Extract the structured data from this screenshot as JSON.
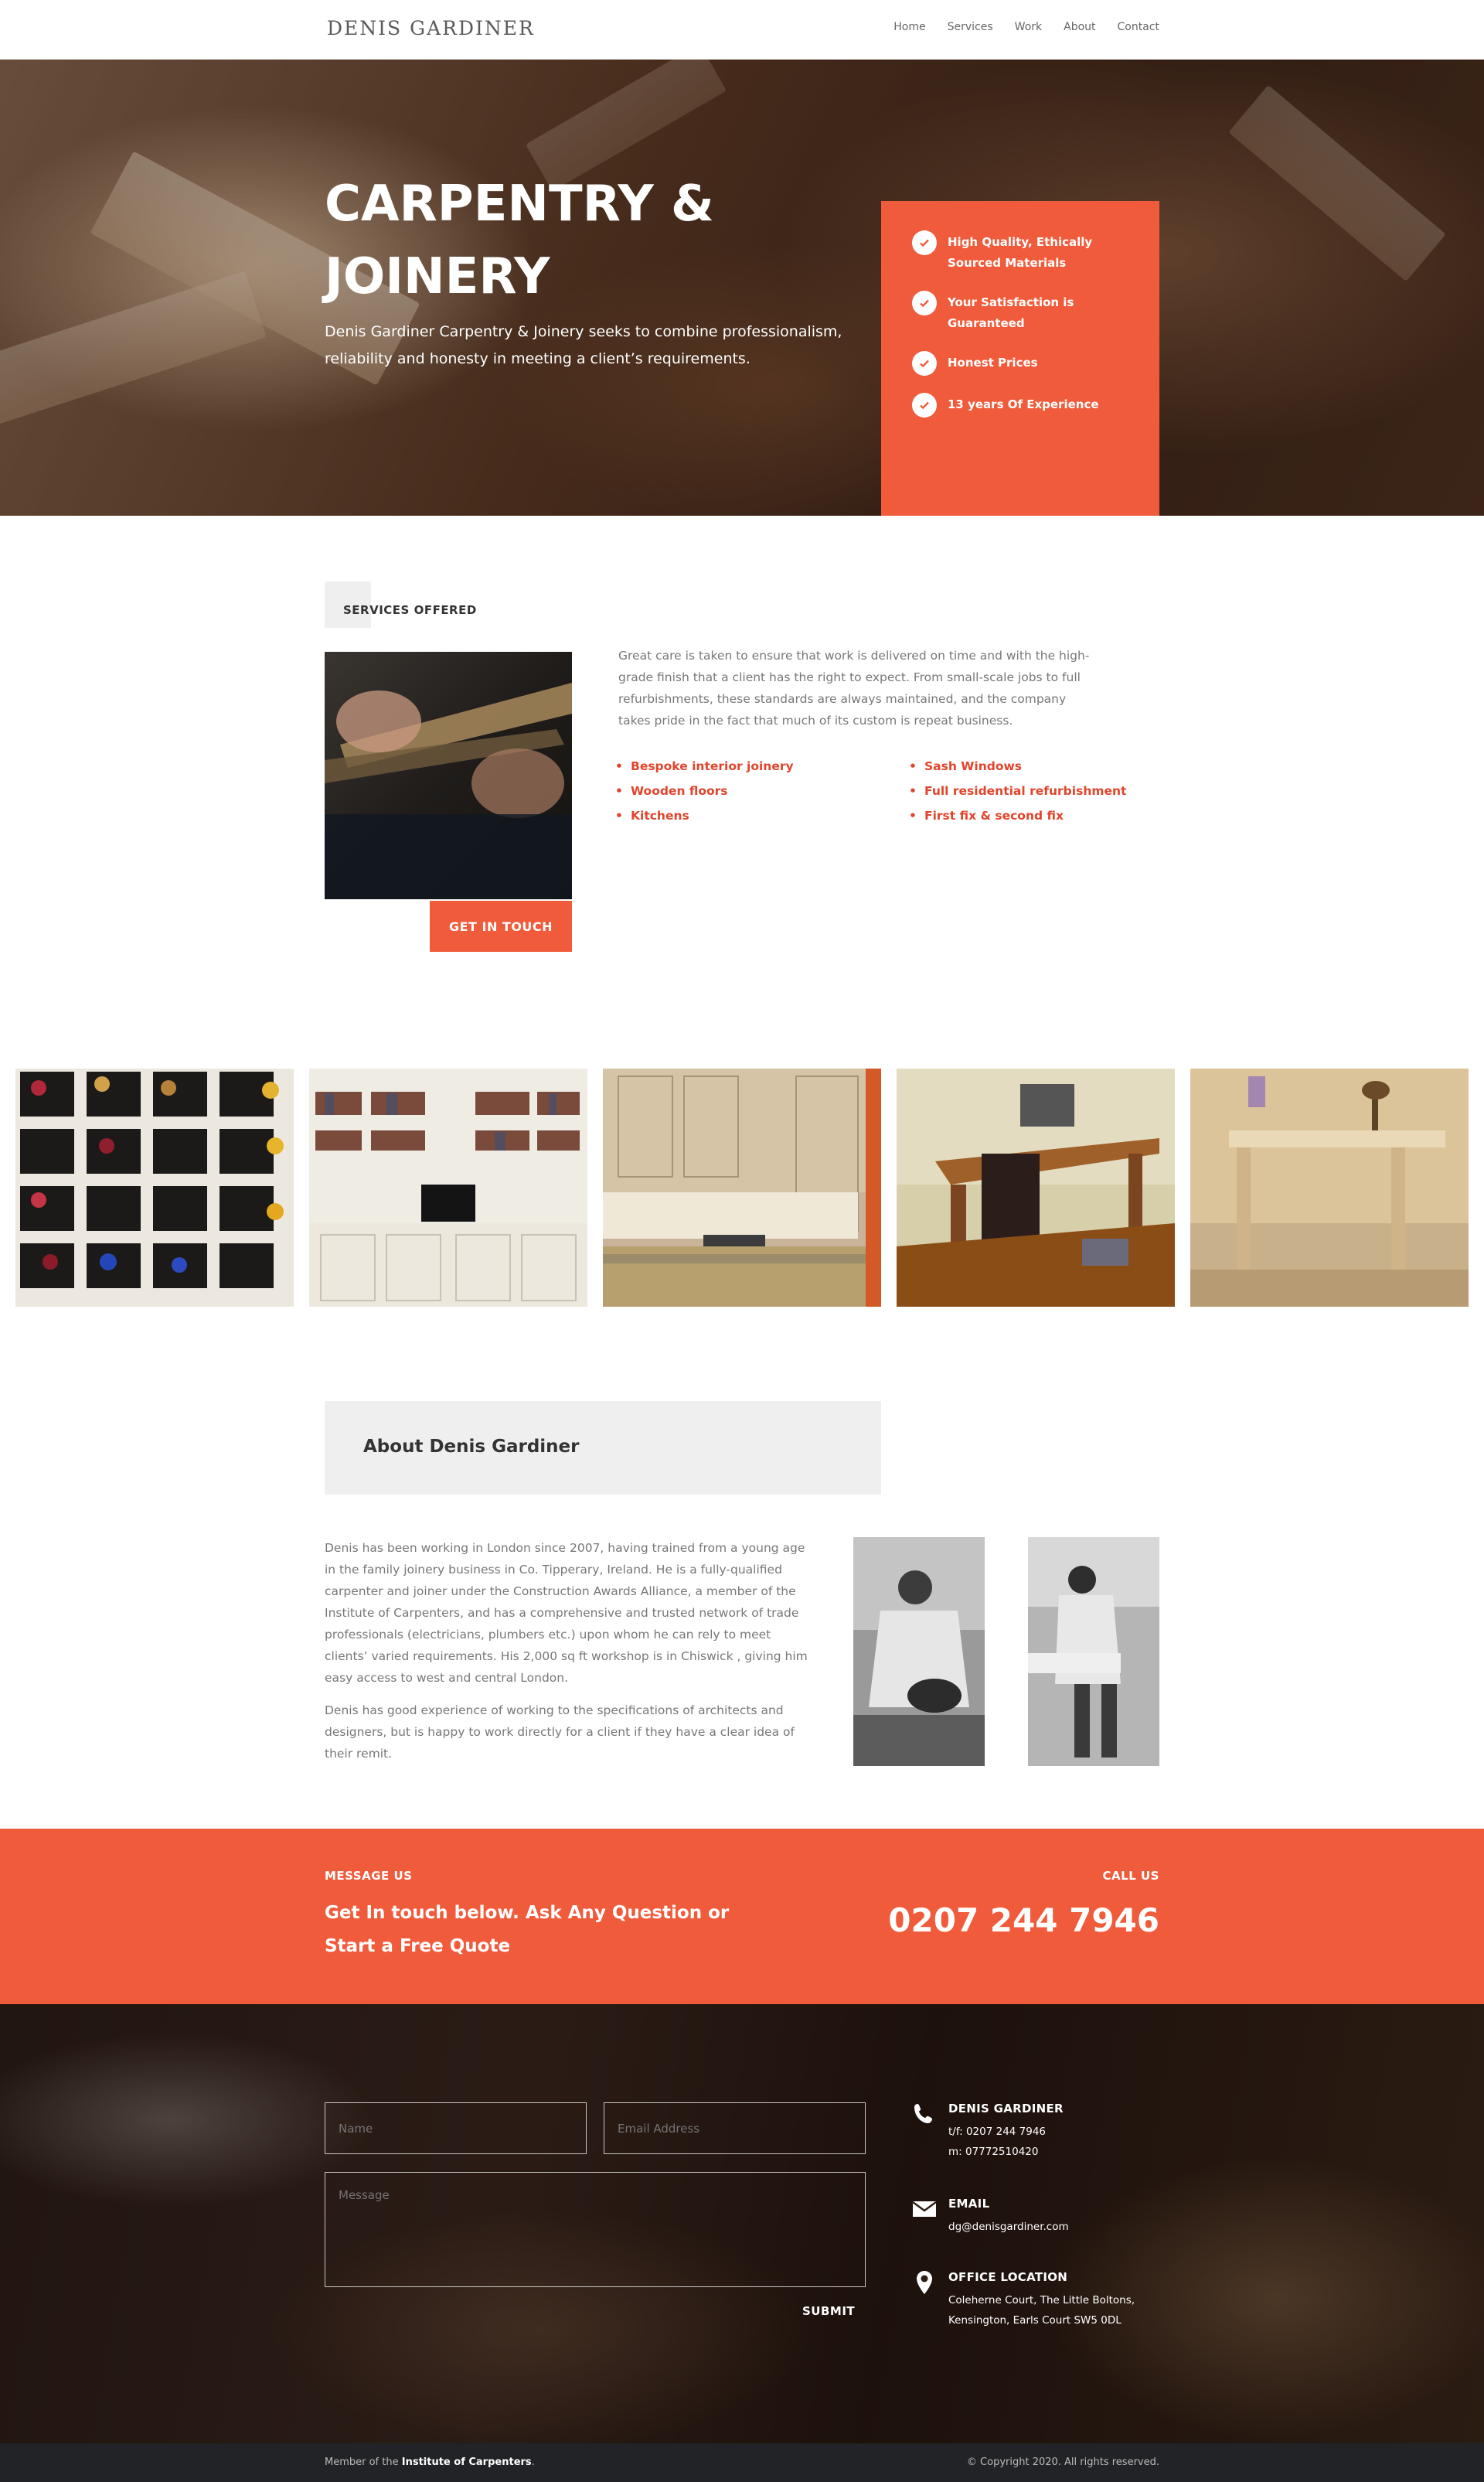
{
  "nav": {
    "logo": "DENIS GARDINER",
    "links": [
      "Home",
      "Services",
      "Work",
      "About",
      "Contact"
    ]
  },
  "hero": {
    "title_line1": "CARPENTRY &",
    "title_line2": "JOINERY",
    "subtitle": "Denis Gardiner Carpentry & Joinery seeks to combine professionalism, reliability and honesty in meeting a client’s requirements.",
    "features": [
      "High Quality, Ethically Sourced Materials",
      "Your Satisfaction is Guaranteed",
      "Honest Prices",
      "13 years Of Experience"
    ]
  },
  "services": {
    "title": "SERVICES OFFERED",
    "button": "GET IN TOUCH",
    "description": "Great care is taken to ensure that work is delivered on time and with the high-grade finish that a client has the right to expect. From small-scale jobs to full refurbishments, these standards are always maintained, and the company takes pride in the fact that much of its custom is repeat business.",
    "list_left": [
      " Bespoke interior joinery",
      "Wooden floors",
      "Kitchens"
    ],
    "list_right": [
      "Sash Windows",
      "Full residential refurbishment",
      "First fix & second fix"
    ]
  },
  "about": {
    "title": "About Denis Gardiner",
    "para1": "Denis has been working in London since 2007, having trained from a young age in the family joinery business in Co. Tipperary, Ireland. He is a fully-qualified carpenter and joiner under the Construction Awards Alliance, a member of the Institute of Carpenters, and has a comprehensive and trusted network of trade professionals (electricians, plumbers etc.) upon whom he can rely to meet clients’ varied requirements. His 2,000 sq ft workshop is in Chiswick , giving him easy access to west and central London.",
    "para2": "Denis has good experience of working to the specifications of architects and designers, but is happy to work directly for a client if they have a clear idea of their remit."
  },
  "cta": {
    "message_label": "MESSAGE US",
    "message_heading": "Get In touch below. Ask Any Question or Start a Free Quote",
    "call_label": "CALL US",
    "phone": "0207 244 7946"
  },
  "form": {
    "name_placeholder": "Name",
    "email_placeholder": "Email Address",
    "message_placeholder": "Message",
    "submit": "SUBMIT"
  },
  "contact_info": {
    "company_title": "DENIS GARDINER",
    "tel": "t/f: 0207 244 7946",
    "mobile": "m: 07772510420",
    "email_title": "EMAIL",
    "email": "dg@denisgardiner.com",
    "office_title": "OFFICE LOCATION",
    "address_line1": "Coleherne Court, The Little Boltons,",
    "address_line2": "Kensington, Earls Court SW5 0DL"
  },
  "footer": {
    "member_prefix": "Member of the ",
    "member_org": "Institute of Carpenters",
    "member_suffix": ".",
    "copyright": "© Copyright 2020. All rights reserved."
  },
  "colors": {
    "accent": "#f05b3b",
    "footer_bg": "#222326",
    "list_text": "#e0452c"
  }
}
